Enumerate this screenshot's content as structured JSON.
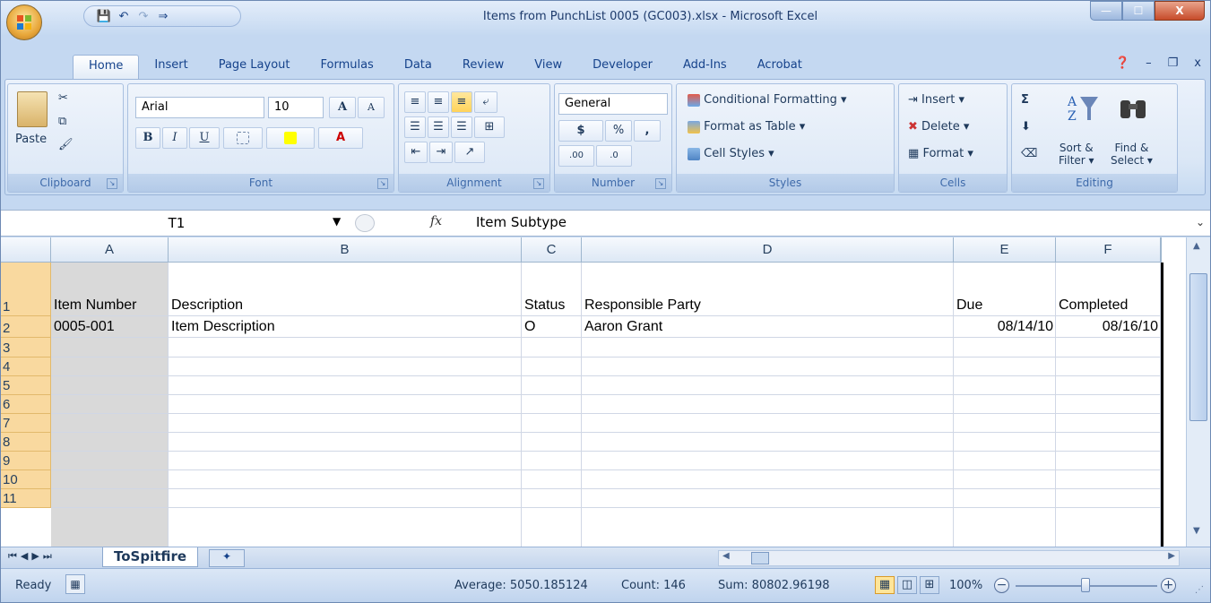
{
  "window": {
    "title": "Items from PunchList 0005 (GC003).xlsx - Microsoft Excel",
    "controls": {
      "minimize": "—",
      "maximize": "☐",
      "close": "X"
    }
  },
  "quick_access": {
    "save": "💾",
    "undo": "↶",
    "redo": "↷",
    "customize": "⇒"
  },
  "tabs": [
    "Home",
    "Insert",
    "Page Layout",
    "Formulas",
    "Data",
    "Review",
    "View",
    "Developer",
    "Add-Ins",
    "Acrobat"
  ],
  "ribbon": {
    "clipboard": {
      "label": "Clipboard",
      "paste": "Paste"
    },
    "font": {
      "label": "Font",
      "name": "Arial",
      "size": "10",
      "bold": "B",
      "italic": "I",
      "underline": "U",
      "grow": "A",
      "shrink": "A"
    },
    "alignment": {
      "label": "Alignment"
    },
    "number": {
      "label": "Number",
      "format": "General",
      "currency": "$",
      "percent": "%",
      "comma": ",",
      "inc": ".00",
      "dec": ".0"
    },
    "styles": {
      "label": "Styles",
      "conditional": "Conditional Formatting",
      "table": "Format as Table",
      "cell": "Cell Styles"
    },
    "cells": {
      "label": "Cells",
      "insert": "Insert",
      "delete": "Delete",
      "format": "Format"
    },
    "editing": {
      "label": "Editing",
      "sigma": "Σ",
      "sort": "Sort &",
      "sort2": "Filter",
      "find": "Find &",
      "find2": "Select"
    }
  },
  "formula_bar": {
    "name_box": "T1",
    "fx": "fx",
    "value": "Item Subtype"
  },
  "columns": [
    "A",
    "B",
    "C",
    "D",
    "E",
    "F"
  ],
  "rows": [
    "1",
    "2",
    "3",
    "4",
    "5",
    "6",
    "7",
    "8",
    "9",
    "10",
    "11"
  ],
  "cells": {
    "A1": "Item Number",
    "B1": "Description",
    "C1": "Status",
    "D1": "Responsible Party",
    "E1": "Due",
    "F1": "Completed",
    "A2": "0005-001",
    "B2": "Item Description",
    "C2": "O",
    "D2": "Aaron Grant",
    "E2": "08/14/10",
    "F2": "08/16/10"
  },
  "sheet": {
    "tab": "ToSpitfire"
  },
  "status": {
    "ready": "Ready",
    "average": "Average: 5050.185124",
    "count": "Count: 146",
    "sum": "Sum: 80802.96198",
    "zoom": "100%"
  },
  "colors": {
    "accent": "#15428b",
    "ribbon": "#dbe7f6",
    "row_header": "#f9d99f"
  }
}
